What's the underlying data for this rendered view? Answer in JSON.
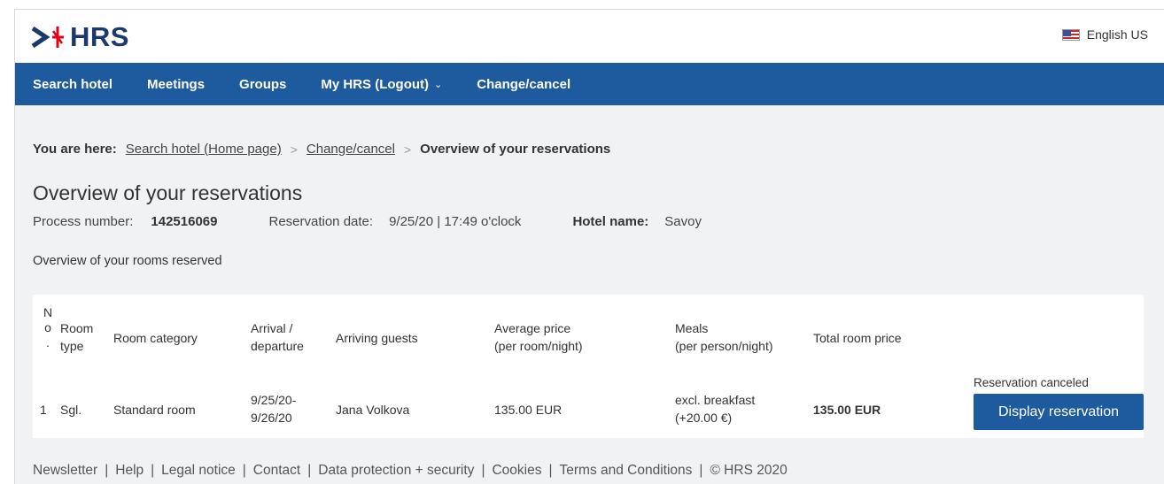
{
  "header": {
    "brand": "HRS",
    "language": "English US"
  },
  "nav": {
    "items": [
      {
        "label": "Search hotel"
      },
      {
        "label": "Meetings"
      },
      {
        "label": "Groups"
      },
      {
        "label": "My HRS (Logout)"
      },
      {
        "label": "Change/cancel"
      }
    ]
  },
  "breadcrumb": {
    "label": "You are here:",
    "links": [
      "Search hotel (Home page)",
      "Change/cancel"
    ],
    "separator": ">",
    "current": "Overview of your reservations"
  },
  "page": {
    "title": "Overview of your reservations",
    "process_number_label": "Process number:",
    "process_number": "142516069",
    "reservation_date_label": "Reservation date:",
    "reservation_date": "9/25/20 | 17:49 o'clock",
    "hotel_name_label": "Hotel name:",
    "hotel_name": "Savoy",
    "rooms_heading": "Overview of your rooms reserved"
  },
  "table": {
    "headers": {
      "no_line1": "N",
      "no_line2": "o",
      "no_line3": ".",
      "room_type_line1": "Room",
      "room_type_line2": "type",
      "room_category": "Room category",
      "arrival_line1": "Arrival /",
      "arrival_line2": "departure",
      "guests": "Arriving guests",
      "avg_price_line1": "Average price",
      "avg_price_line2": "(per room/night)",
      "meals_line1": "Meals",
      "meals_line2": "(per person/night)",
      "total": "Total room price"
    },
    "rows": [
      {
        "no": "1",
        "room_type": "Sgl.",
        "room_category": "Standard room",
        "arrival": "9/25/20-",
        "departure": "9/26/20",
        "guests": "Jana Volkova",
        "avg_price": "135.00 EUR",
        "meals_line1": "excl. breakfast",
        "meals_line2": "(+20.00 €)",
        "total": "135.00 EUR",
        "status": "Reservation canceled",
        "action_label": "Display reservation"
      }
    ]
  },
  "footer": {
    "links": [
      "Newsletter",
      "Help",
      "Legal notice",
      "Contact",
      "Data protection + security",
      "Cookies",
      "Terms and Conditions",
      "© HRS 2020"
    ],
    "separator": "|"
  },
  "colors": {
    "brand_blue": "#1e5a9e",
    "logo_navy": "#1b3a6b",
    "logo_red": "#e2001a"
  }
}
